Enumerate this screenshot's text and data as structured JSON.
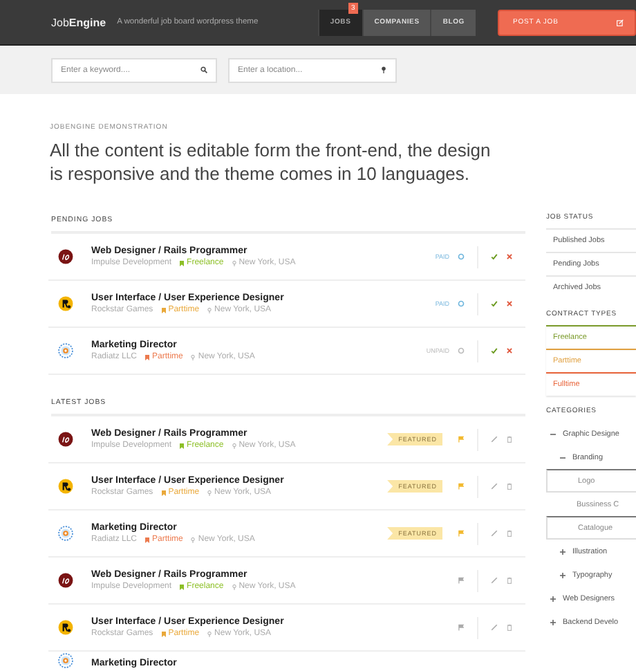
{
  "header": {
    "brand_light": "Job",
    "brand_bold": "Engine",
    "tagline": "A wonderful job board wordpress theme",
    "nav": [
      {
        "label": "JOBS",
        "selected": true,
        "badge": "3"
      },
      {
        "label": "COMPANIES",
        "selected": false
      },
      {
        "label": "BLOG",
        "selected": false
      }
    ],
    "post_button": "POST A JOB"
  },
  "search": {
    "keyword_placeholder": "Enter a keyword....",
    "location_placeholder": "Enter a location..."
  },
  "intro": {
    "eyebrow": "JOBENGINE DEMONSTRATION",
    "headline": "All the content is editable form the front-end, the design is responsive and the theme comes in 10 languages."
  },
  "pending_jobs": {
    "heading": "PENDING JOBS",
    "rows": [
      {
        "logo": {
          "kind": "impulse"
        },
        "title": "Web Designer / Rails Programmer",
        "company": "Impulse Development",
        "contract": "Freelance",
        "color": "#8cbf26",
        "location": "New York, USA",
        "payment": "PAID",
        "paid": true
      },
      {
        "logo": {
          "kind": "rockstar"
        },
        "title": "User Interface / User Experience Designer",
        "company": "Rockstar Games",
        "contract": "Parttime",
        "color": "#e9a83a",
        "location": "New York, USA",
        "payment": "PAID",
        "paid": true
      },
      {
        "logo": {
          "kind": "radiatz"
        },
        "title": "Marketing Director",
        "company": "Radiatz LLC",
        "contract": "Parttime",
        "color": "#ec7a4e",
        "location": "New York, USA",
        "payment": "UNPAID",
        "paid": false
      }
    ]
  },
  "latest_jobs": {
    "heading": "LATEST JOBS",
    "rows": [
      {
        "logo": {
          "kind": "impulse"
        },
        "title": "Web Designer / Rails Programmer",
        "company": "Impulse Development",
        "contract": "Freelance",
        "color": "#8cbf26",
        "location": "New York, USA",
        "featured": true,
        "featured_label": "FEATURED"
      },
      {
        "logo": {
          "kind": "rockstar"
        },
        "title": "User Interface / User Experience Designer",
        "company": "Rockstar Games",
        "contract": "Parttime",
        "color": "#e9a83a",
        "location": "New York, USA",
        "featured": true,
        "featured_label": "FEATURED"
      },
      {
        "logo": {
          "kind": "radiatz"
        },
        "title": "Marketing Director",
        "company": "Radiatz LLC",
        "contract": "Parttime",
        "color": "#ec7a4e",
        "location": "New York, USA",
        "featured": true,
        "featured_label": "FEATURED"
      },
      {
        "logo": {
          "kind": "impulse"
        },
        "title": "Web Designer / Rails Programmer",
        "company": "Impulse Development",
        "contract": "Freelance",
        "color": "#8cbf26",
        "location": "New York, USA",
        "featured": false
      },
      {
        "logo": {
          "kind": "rockstar"
        },
        "title": "User Interface / User Experience Designer",
        "company": "Rockstar Games",
        "contract": "Parttime",
        "color": "#e9a83a",
        "location": "New York, USA",
        "featured": false
      },
      {
        "logo": {
          "kind": "radiatz"
        },
        "title": "Marketing Director"
      }
    ]
  },
  "sidebar": {
    "job_status": {
      "heading": "JOB STATUS",
      "items": [
        "Published Jobs",
        "Pending Jobs",
        "Archived Jobs"
      ]
    },
    "contract_types": {
      "heading": "CONTRACT TYPES",
      "items": [
        {
          "label": "Freelance",
          "color": "#7a9a2a"
        },
        {
          "label": "Parttime",
          "color": "#e0a040"
        },
        {
          "label": "Fulltime",
          "color": "#e8643a"
        }
      ]
    },
    "categories": {
      "heading": "CATEGORIES",
      "items": [
        {
          "label": "Graphic Designe",
          "expanded": true,
          "children": [
            {
              "label": "Branding",
              "expanded": true,
              "children": [
                {
                  "label": "Logo",
                  "boxed": true
                },
                {
                  "label": "Bussiness C",
                  "boxed": false
                },
                {
                  "label": "Catalogue",
                  "boxed": true
                }
              ]
            },
            {
              "label": "Illustration",
              "expanded": false
            },
            {
              "label": "Typography",
              "expanded": false
            }
          ]
        },
        {
          "label": "Web Designers",
          "expanded": false
        },
        {
          "label": "Backend Develo",
          "expanded": false
        }
      ]
    }
  }
}
